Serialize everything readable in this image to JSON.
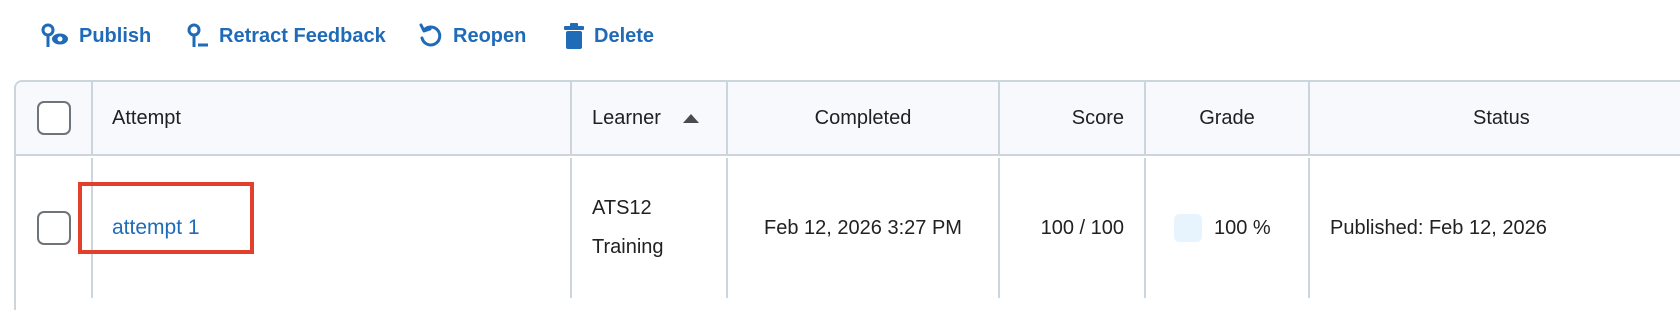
{
  "toolbar": {
    "publish_label": "Publish",
    "retract_label": "Retract Feedback",
    "reopen_label": "Reopen",
    "delete_label": "Delete",
    "accent_color": "#1f6bb8"
  },
  "table": {
    "headers": {
      "attempt": "Attempt",
      "learner": "Learner",
      "completed": "Completed",
      "score": "Score",
      "grade": "Grade",
      "status": "Status"
    },
    "sorted_column": "learner",
    "sort_direction": "ascending",
    "rows": [
      {
        "attempt": "attempt 1",
        "learner_line1": "ATS12",
        "learner_line2": "Training",
        "completed": "Feb 12, 2026 3:27 PM",
        "score": "100 / 100",
        "grade": "100 %",
        "status": "Published: Feb 12, 2026"
      }
    ]
  },
  "highlight_color": "#e0402c"
}
